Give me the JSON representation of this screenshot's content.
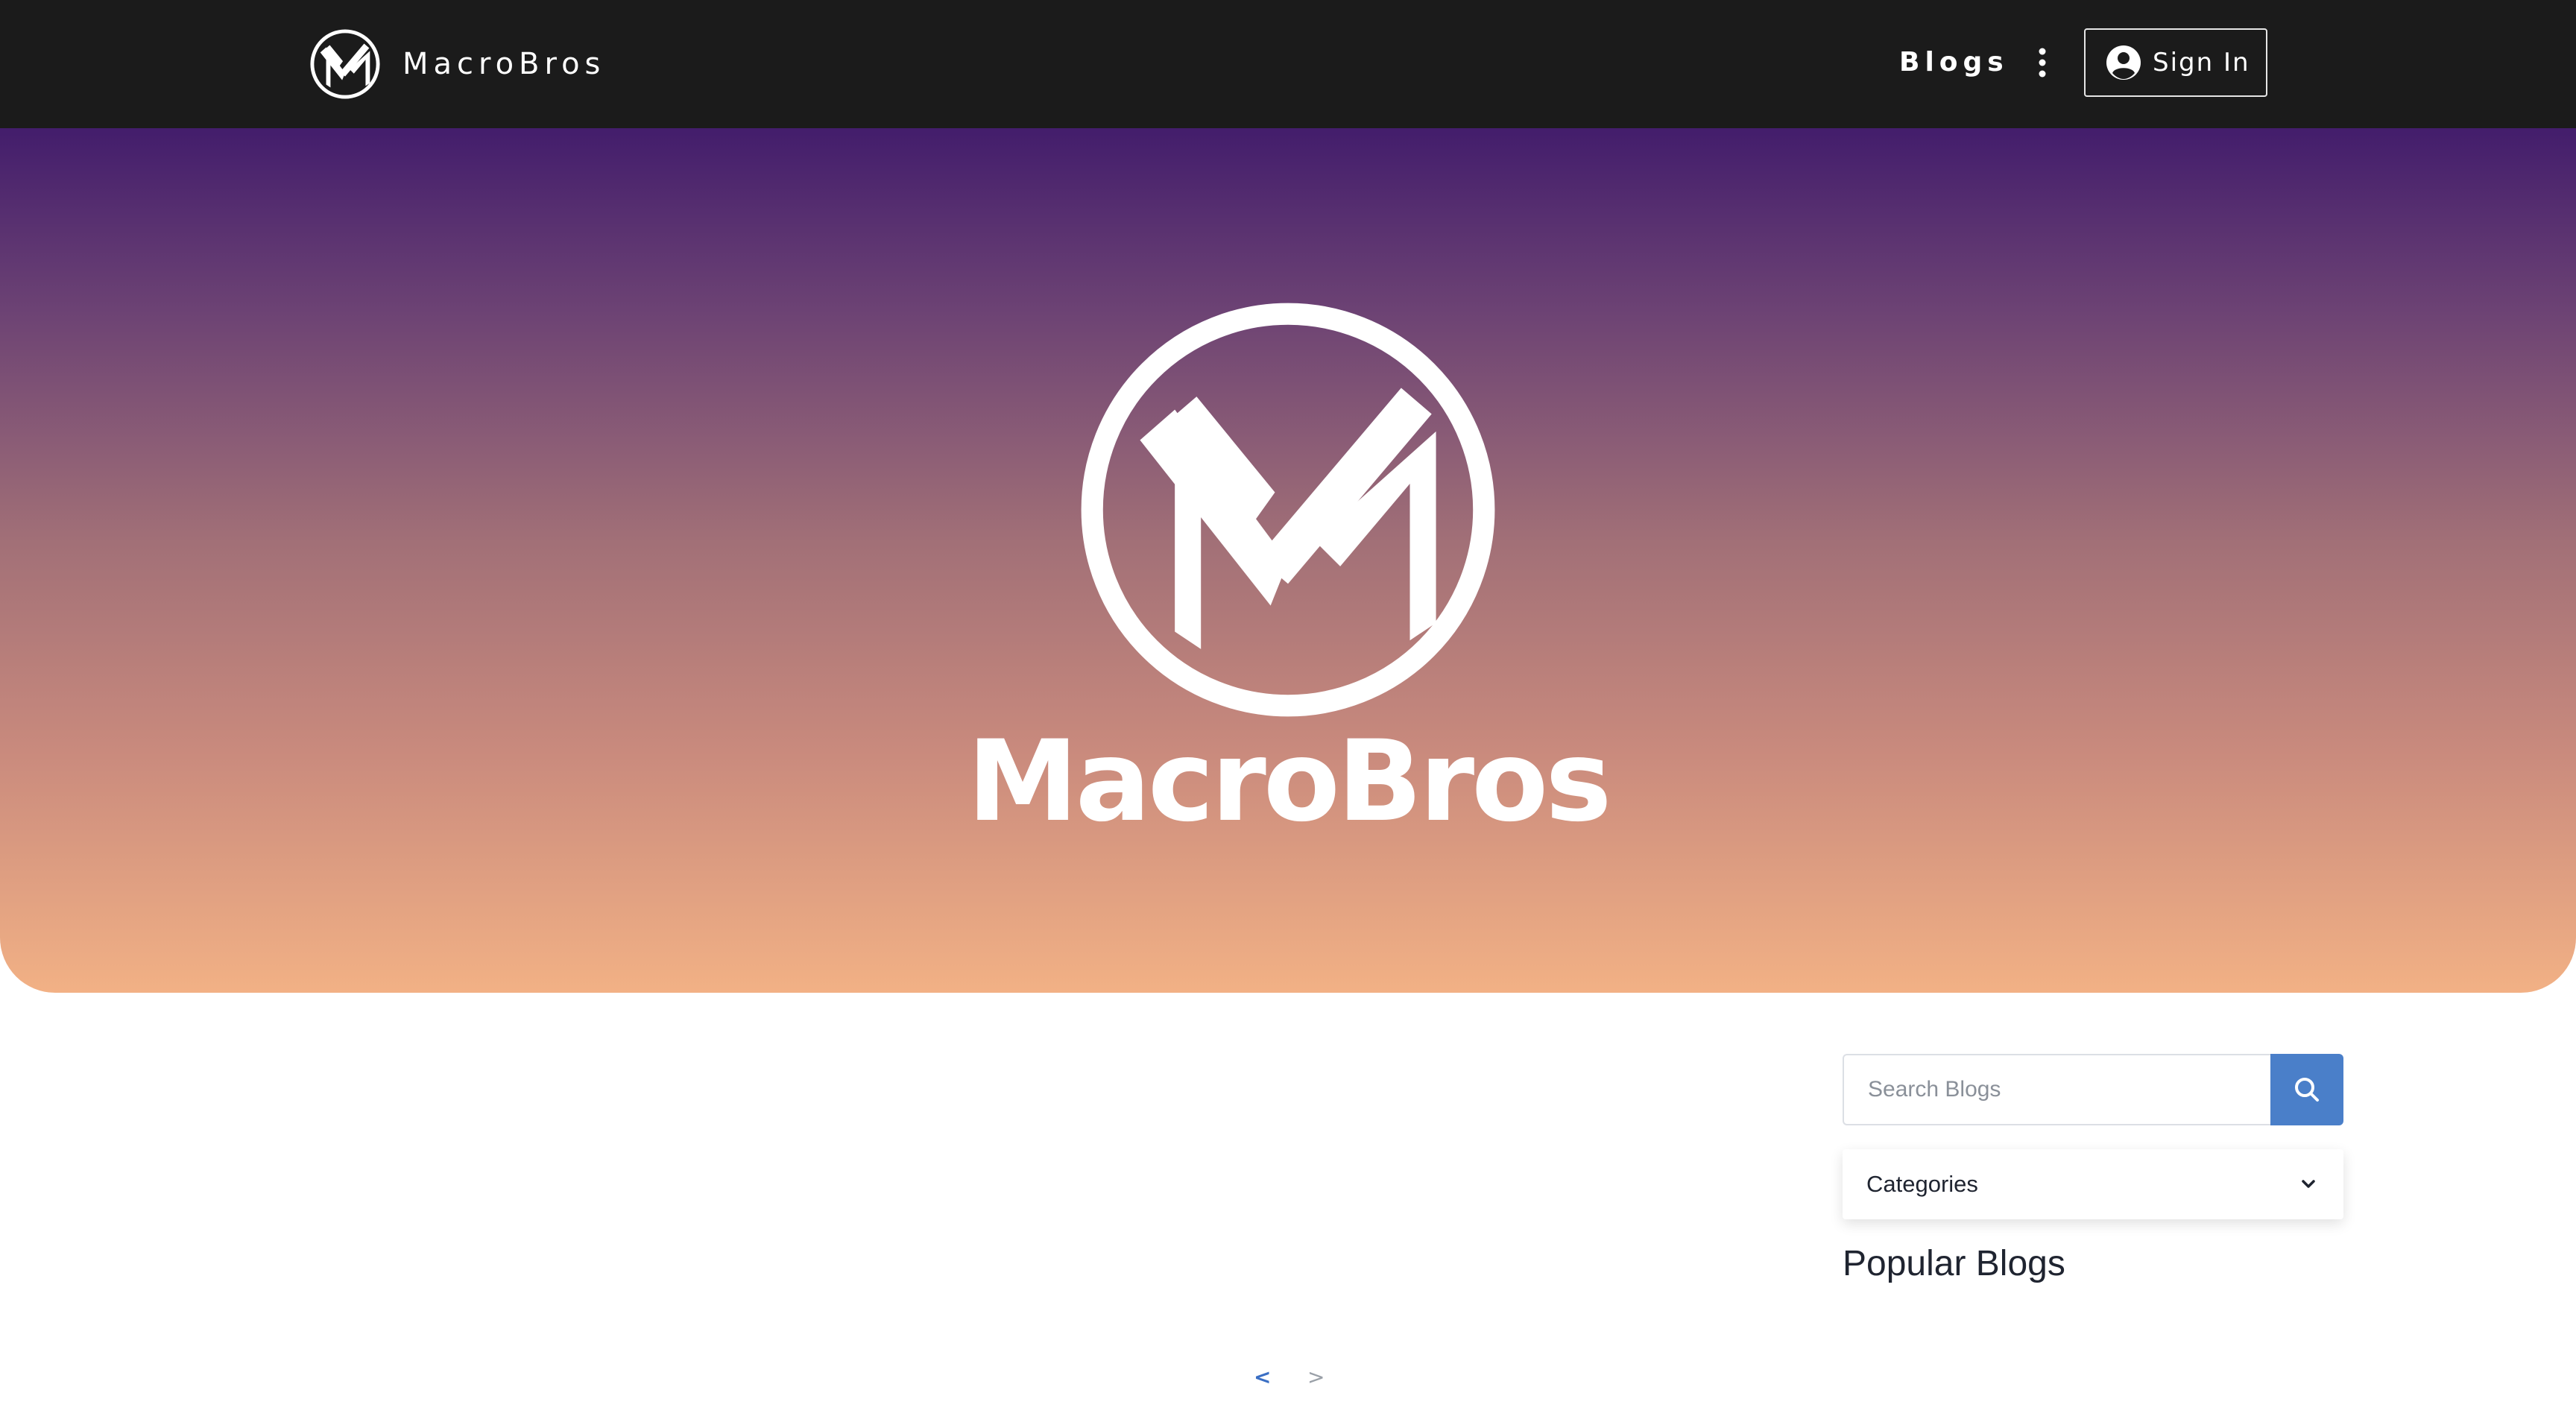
{
  "navbar": {
    "brand_name": "MacroBros",
    "blogs_label": "Blogs",
    "signin_label": "Sign In"
  },
  "hero": {
    "title": "MacroBros"
  },
  "sidebar": {
    "search_placeholder": "Search Blogs",
    "categories_label": "Categories",
    "popular_title": "Popular Blogs"
  },
  "pagination": {
    "prev_label": "<",
    "next_label": ">"
  },
  "colors": {
    "navbar_bg": "#1b1b1b",
    "hero_gradient_top": "#431d6c",
    "hero_gradient_bottom": "#f2b185",
    "accent_blue": "#4a7fc9"
  },
  "icons": {
    "brand_logo": "macrobros-logo-icon",
    "kebab": "kebab-menu-icon",
    "user": "user-circle-icon",
    "search": "search-icon",
    "chevron": "chevron-down-icon"
  }
}
